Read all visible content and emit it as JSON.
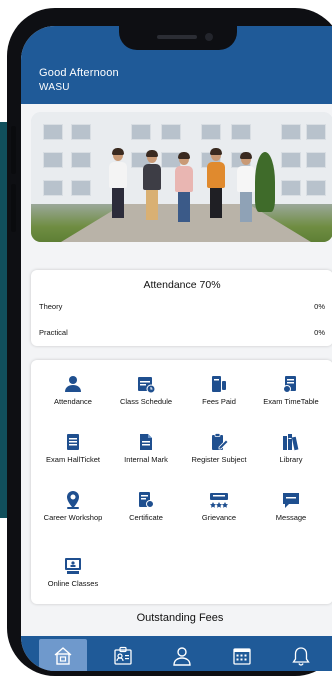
{
  "header": {
    "greeting": "Good Afternoon",
    "username": "WASU"
  },
  "hero": {
    "icon": "students-photo"
  },
  "attendance": {
    "title": "Attendance 70%",
    "rows": [
      {
        "label": "Theory",
        "value": "0%"
      },
      {
        "label": "Practical",
        "value": "0%"
      }
    ]
  },
  "menu": [
    {
      "label": "Attendance",
      "icon": "person-icon"
    },
    {
      "label": "Class Schedule",
      "icon": "calendar-clock-icon"
    },
    {
      "label": "Fees Paid",
      "icon": "fees-icon"
    },
    {
      "label": "Exam TimeTable",
      "icon": "exam-timetable-icon"
    },
    {
      "label": "Exam HallTicket",
      "icon": "hallticket-icon"
    },
    {
      "label": "Internal Mark",
      "icon": "document-icon"
    },
    {
      "label": "Register Subject",
      "icon": "edit-clipboard-icon"
    },
    {
      "label": "Library",
      "icon": "books-icon"
    },
    {
      "label": "Career Workshop",
      "icon": "location-pin-icon"
    },
    {
      "label": "Certificate",
      "icon": "certificate-icon"
    },
    {
      "label": "Grievance",
      "icon": "rating-stars-icon"
    },
    {
      "label": "Message",
      "icon": "chat-icon"
    },
    {
      "label": "Online Classes",
      "icon": "online-class-icon"
    }
  ],
  "outstanding_label": "Outstanding Fees",
  "bottom_nav": [
    "home-icon",
    "id-card-icon",
    "profile-icon",
    "calendar-icon",
    "bell-icon"
  ],
  "colors": {
    "header": "#1f5a98",
    "icon": "#1f4f8f",
    "nav_active": "#6f99cc",
    "side_panel": "#114f5c"
  }
}
